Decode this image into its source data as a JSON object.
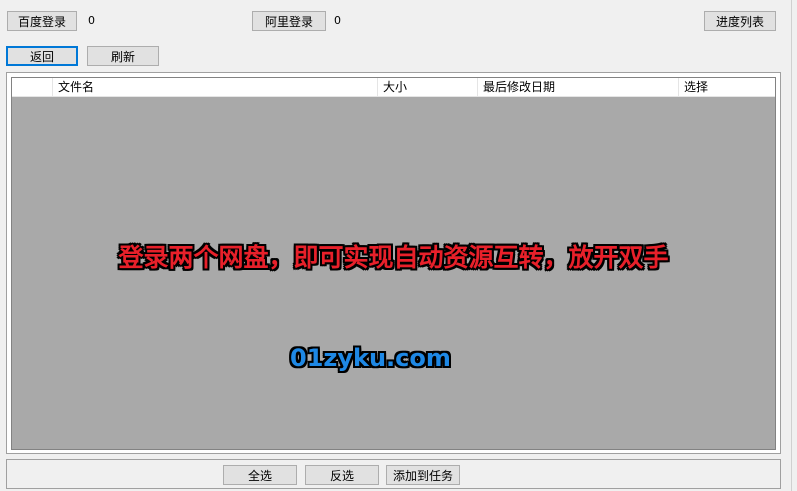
{
  "toolbar": {
    "baidu_login_label": "百度登录",
    "baidu_count": "0",
    "ali_login_label": "阿里登录",
    "ali_count": "0",
    "progress_list_label": "进度列表",
    "back_label": "返回",
    "refresh_label": "刷新"
  },
  "file_list": {
    "columns": [
      "文件名",
      "大小",
      "最后修改日期",
      "选择"
    ],
    "rows": []
  },
  "overlay": {
    "promo_text": "登录两个网盘，即可实现自动资源互转，放开双手",
    "url_text": "01zyku.com"
  },
  "bottom_bar": {
    "select_all_label": "全选",
    "invert_label": "反选",
    "add_task_label": "添加到任务"
  }
}
